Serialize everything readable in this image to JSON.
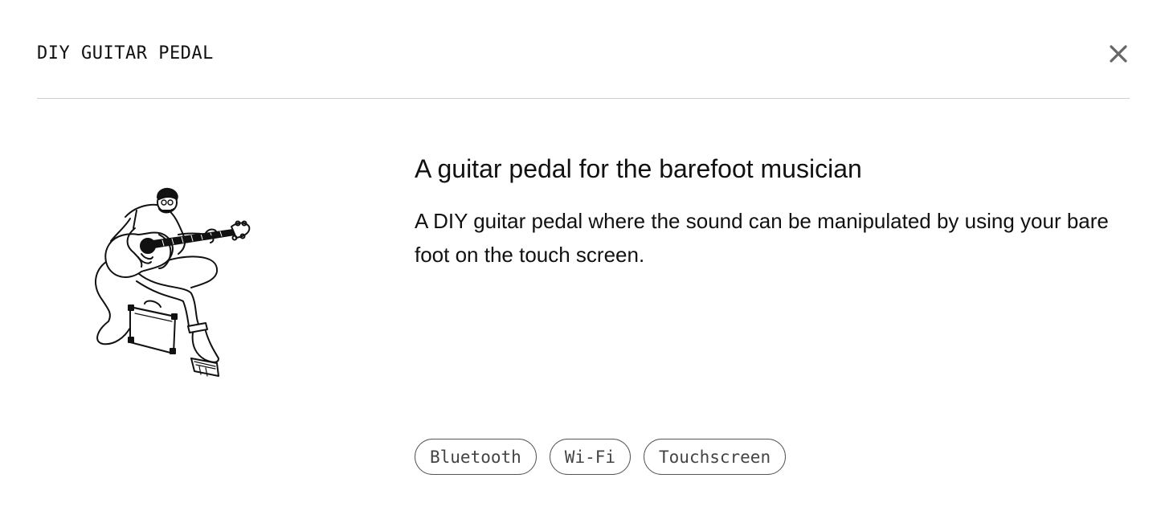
{
  "modal": {
    "title": "DIY GUITAR PEDAL",
    "close_icon": "close-icon"
  },
  "illustration": {
    "icon": "guitarist-illustration"
  },
  "content": {
    "heading": "A guitar pedal for the barefoot musician",
    "description": "A DIY guitar pedal where the sound can be manipulated by using your bare foot on the touch screen."
  },
  "tags": [
    {
      "label": "Bluetooth"
    },
    {
      "label": "Wi-Fi"
    },
    {
      "label": "Touchscreen"
    }
  ],
  "colors": {
    "text": "#111111",
    "divider": "#cfcfcf",
    "tag_border": "#555555",
    "tag_text": "#444444",
    "close_icon": "#666666"
  }
}
